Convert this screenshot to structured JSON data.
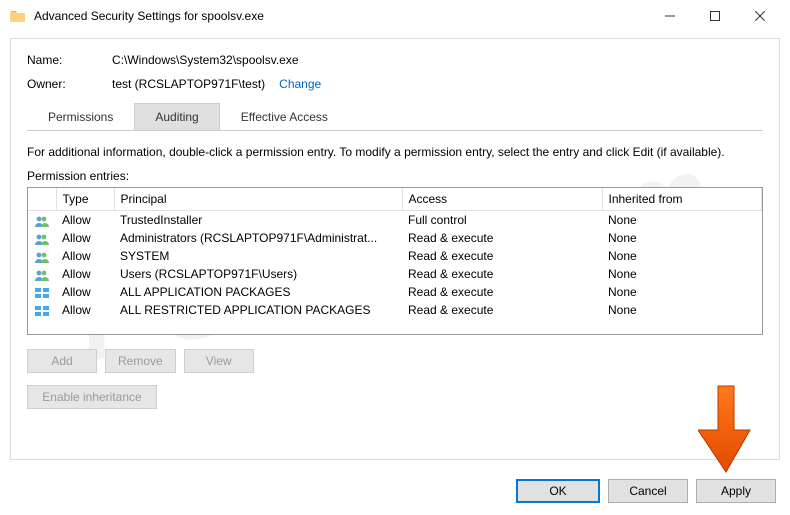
{
  "titlebar": {
    "title": "Advanced Security Settings for spoolsv.exe"
  },
  "fields": {
    "name_label": "Name:",
    "name_value": "C:\\Windows\\System32\\spoolsv.exe",
    "owner_label": "Owner:",
    "owner_value": "test (RCSLAPTOP971F\\test)",
    "change_link": "Change"
  },
  "tabs": {
    "t0": "Permissions",
    "t1": "Auditing",
    "t2": "Effective Access",
    "active_index": 1
  },
  "info_line": "For additional information, double-click a permission entry. To modify a permission entry, select the entry and click Edit (if available).",
  "entries_label": "Permission entries:",
  "table": {
    "headers": {
      "type": "Type",
      "principal": "Principal",
      "access": "Access",
      "inherited": "Inherited from"
    },
    "rows": [
      {
        "icon": "users",
        "type": "Allow",
        "principal": "TrustedInstaller",
        "access": "Full control",
        "inherited": "None"
      },
      {
        "icon": "users",
        "type": "Allow",
        "principal": "Administrators (RCSLAPTOP971F\\Administrat...",
        "access": "Read & execute",
        "inherited": "None"
      },
      {
        "icon": "users",
        "type": "Allow",
        "principal": "SYSTEM",
        "access": "Read & execute",
        "inherited": "None"
      },
      {
        "icon": "users",
        "type": "Allow",
        "principal": "Users (RCSLAPTOP971F\\Users)",
        "access": "Read & execute",
        "inherited": "None"
      },
      {
        "icon": "pkg",
        "type": "Allow",
        "principal": "ALL APPLICATION PACKAGES",
        "access": "Read & execute",
        "inherited": "None"
      },
      {
        "icon": "pkg",
        "type": "Allow",
        "principal": "ALL RESTRICTED APPLICATION PACKAGES",
        "access": "Read & execute",
        "inherited": "None"
      }
    ]
  },
  "buttons": {
    "add": "Add",
    "remove": "Remove",
    "view": "View",
    "enable_inheritance": "Enable inheritance",
    "ok": "OK",
    "cancel": "Cancel",
    "apply": "Apply"
  },
  "watermark": "PCrisk.com"
}
